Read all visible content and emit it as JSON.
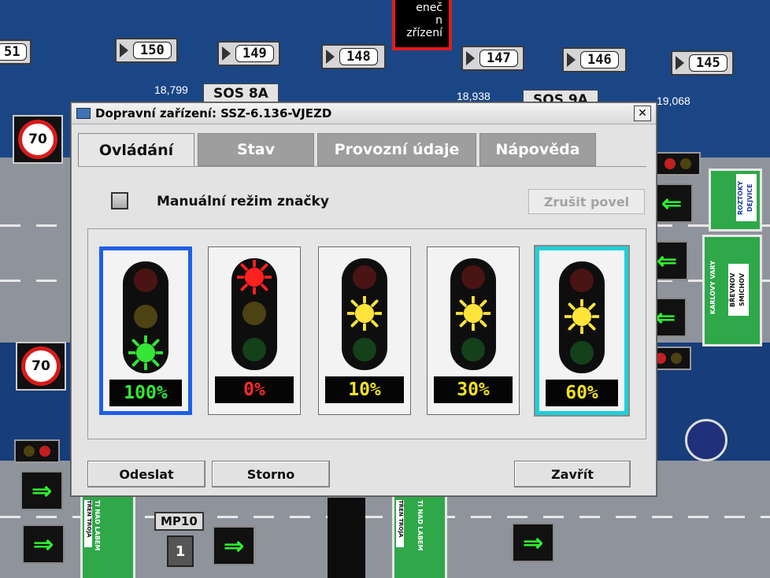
{
  "background": {
    "km_markers": [
      "51",
      "150",
      "149",
      "148",
      "147",
      "146",
      "145"
    ],
    "distances": [
      "18,799",
      "18,938",
      "19,068"
    ],
    "sos_labels": [
      "SOS 8A",
      "SOS 9A"
    ],
    "speed_limits": [
      "70",
      "70"
    ],
    "red_box_text": [
      "eneč",
      "n",
      "zřízení"
    ],
    "mp_label": "MP10",
    "green_sign_1": [
      "ROZTOKY",
      "DEJVICE"
    ],
    "green_sign_2": [
      "BŘEVNOV",
      "SMÍCHOV",
      "KARLOVY VARY"
    ],
    "green_sign_3": [
      "TI NAD LABEM",
      "TŘEŇ TROJA"
    ],
    "green_sign_4": [
      "TI NAD LABEM",
      "TŘEŇ TROJA"
    ],
    "counter": "1"
  },
  "dialog": {
    "title": "Dopravní zařízení: SSZ-6.136-VJEZD",
    "close_glyph": "✕",
    "tabs": [
      "Ovládání",
      "Stav",
      "Provozní údaje",
      "Nápověda"
    ],
    "active_tab": "Ovládání",
    "manual_mode_label": "Manuální režim značky",
    "cancel_command_label": "Zrušit povel",
    "options": [
      {
        "active_light": "green",
        "percent": "100%",
        "pct_color": "#35e535"
      },
      {
        "active_light": "red",
        "percent": "0%",
        "pct_color": "#ff2a2a"
      },
      {
        "active_light": "yellow",
        "percent": "10%",
        "pct_color": "#f0e020"
      },
      {
        "active_light": "yellow",
        "percent": "30%",
        "pct_color": "#f0e020"
      },
      {
        "active_light": "yellow",
        "percent": "60%",
        "pct_color": "#f0e020"
      }
    ],
    "buttons": {
      "send": "Odeslat",
      "cancel": "Storno",
      "close": "Zavřít"
    }
  },
  "colors": {
    "red_on": "#ff2020",
    "yellow_on": "#ffe43a",
    "green_on": "#35e535",
    "red_off": "#4a1414",
    "yellow_off": "#4d4212",
    "green_off": "#14401a"
  }
}
